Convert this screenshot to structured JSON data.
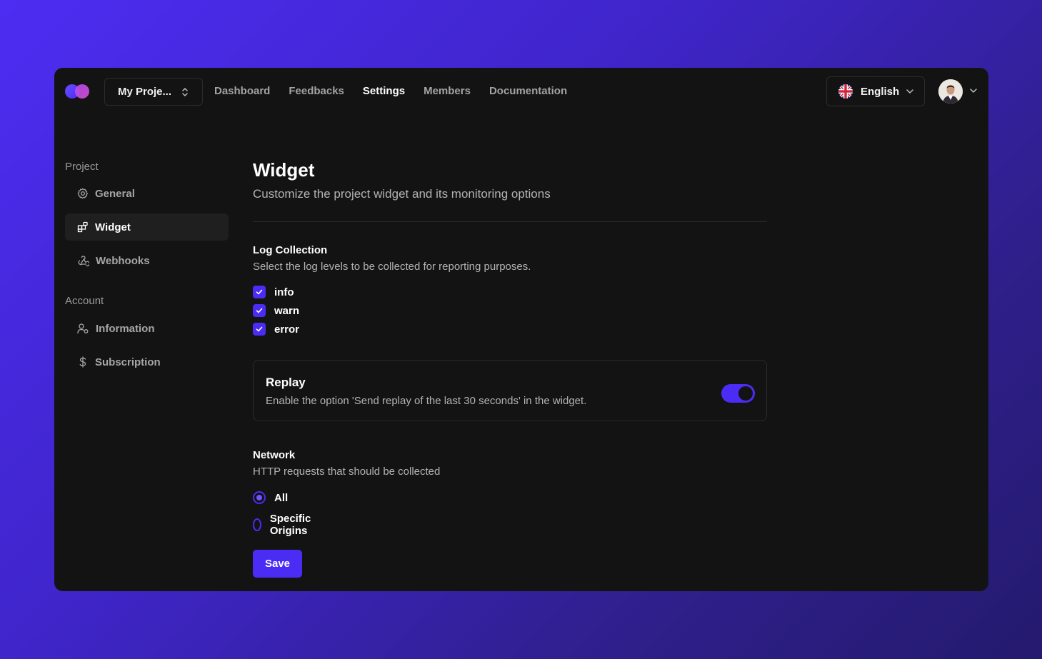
{
  "header": {
    "project_selector": "My Proje...",
    "nav": [
      {
        "label": "Dashboard",
        "active": false
      },
      {
        "label": "Feedbacks",
        "active": false
      },
      {
        "label": "Settings",
        "active": true
      },
      {
        "label": "Members",
        "active": false
      },
      {
        "label": "Documentation",
        "active": false
      }
    ],
    "language": "English",
    "language_icon": "uk-flag-icon"
  },
  "sidebar": {
    "project_label": "Project",
    "project_items": [
      {
        "label": "General",
        "icon": "gear-icon"
      },
      {
        "label": "Widget",
        "icon": "widget-icon",
        "active": true
      },
      {
        "label": "Webhooks",
        "icon": "webhook-icon"
      }
    ],
    "account_label": "Account",
    "account_items": [
      {
        "label": "Information",
        "icon": "user-icon"
      },
      {
        "label": "Subscription",
        "icon": "dollar-icon"
      }
    ]
  },
  "main": {
    "title": "Widget",
    "subtitle": "Customize the project widget and its monitoring options",
    "log_collection": {
      "title": "Log Collection",
      "description": "Select the log levels to be collected for reporting purposes.",
      "levels": [
        {
          "label": "info",
          "checked": true
        },
        {
          "label": "warn",
          "checked": true
        },
        {
          "label": "error",
          "checked": true
        }
      ]
    },
    "replay": {
      "title": "Replay",
      "description": "Enable the option 'Send replay of the last 30 seconds' in the widget.",
      "enabled": true
    },
    "network": {
      "title": "Network",
      "description": "HTTP requests that should be collected",
      "options": [
        {
          "label": "All",
          "selected": true
        },
        {
          "label": "Specific Origins",
          "selected": false
        }
      ]
    },
    "save_label": "Save"
  },
  "colors": {
    "accent": "#4b2cf5",
    "panel": "#131313",
    "background_start": "#4d2df2",
    "background_end": "#241a6e"
  }
}
